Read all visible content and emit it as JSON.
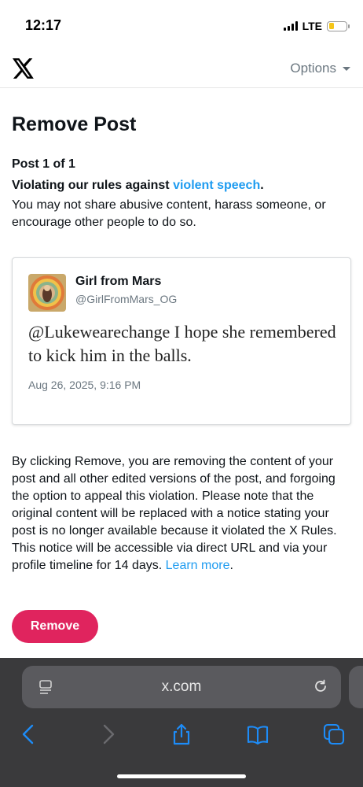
{
  "status_bar": {
    "time": "12:17",
    "network": "LTE",
    "battery_level": 0.3
  },
  "header": {
    "logo_icon": "x-logo-icon",
    "options_label": "Options"
  },
  "page": {
    "title": "Remove Post",
    "post_count": "Post 1 of 1",
    "violation_prefix": "Violating our rules against ",
    "violation_link": "violent speech",
    "violation_suffix": ".",
    "rule_description": "You may not share abusive content, harass someone, or encourage other people to do so."
  },
  "tweet": {
    "author_name": "Girl from Mars",
    "author_handle": "@GirlFromMars_OG",
    "text": "@Lukewearechange I hope she remembered to kick him in the balls.",
    "timestamp": "Aug 26, 2025, 9:16 PM"
  },
  "notice": {
    "body": "By clicking Remove, you are removing the content of your post and all other edited versions of the post, and forgoing the option to appeal this violation. Please note that the original content will be replaced with a notice stating your post is no longer available because it violated the X Rules. This notice will be accessible via direct URL and via your profile timeline for 14 days.",
    "learn_more": "Learn more",
    "end_punct": "."
  },
  "remove_button": {
    "label": "Remove"
  },
  "browser": {
    "url": "x.com",
    "colors": {
      "accent": "#1d9bf0",
      "remove": "#e0245e",
      "chrome": "#3a3a3c"
    }
  }
}
